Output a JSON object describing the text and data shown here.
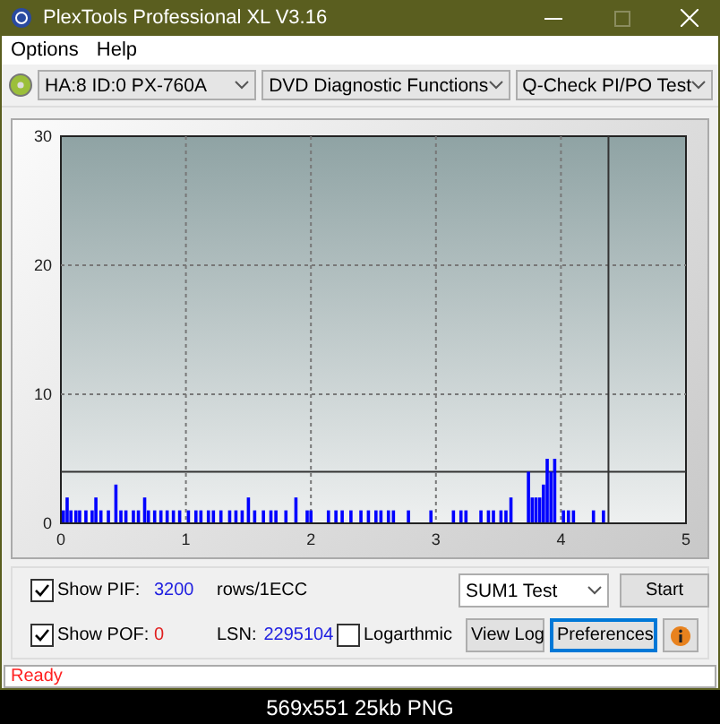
{
  "window": {
    "title": "PlexTools Professional XL V3.16"
  },
  "menu": [
    {
      "label": "Options"
    },
    {
      "label": "Help"
    }
  ],
  "selectors": [
    {
      "value": "HA:8 ID:0  PX-760A"
    },
    {
      "value": "DVD Diagnostic Functions"
    },
    {
      "value": "Q-Check PI/PO Test"
    }
  ],
  "chart": {
    "chart_data": {
      "type": "bar",
      "xlim": [
        0,
        5
      ],
      "ylim": [
        0,
        30
      ],
      "xticks": [
        0,
        1,
        2,
        3,
        4,
        5
      ],
      "yticks": [
        0,
        10,
        20,
        30
      ],
      "grid": true,
      "x": [
        0.02,
        0.05,
        0.08,
        0.12,
        0.15,
        0.2,
        0.25,
        0.28,
        0.32,
        0.38,
        0.44,
        0.48,
        0.52,
        0.58,
        0.62,
        0.67,
        0.7,
        0.75,
        0.8,
        0.85,
        0.9,
        0.95,
        1.02,
        1.08,
        1.12,
        1.18,
        1.22,
        1.28,
        1.35,
        1.4,
        1.45,
        1.5,
        1.55,
        1.62,
        1.68,
        1.72,
        1.8,
        1.88,
        1.97,
        2.0,
        2.14,
        2.2,
        2.25,
        2.32,
        2.4,
        2.46,
        2.52,
        2.56,
        2.62,
        2.66,
        2.78,
        2.96,
        3.14,
        3.2,
        3.24,
        3.36,
        3.42,
        3.46,
        3.52,
        3.56,
        3.6,
        3.74,
        3.77,
        3.8,
        3.83,
        3.86,
        3.89,
        3.92,
        3.95,
        4.02,
        4.06,
        4.1,
        4.26,
        4.34
      ],
      "series": [
        {
          "color": "#0000ff",
          "values": [
            1,
            2,
            1,
            1,
            1,
            1,
            1,
            2,
            1,
            1,
            3,
            1,
            1,
            1,
            1,
            2,
            1,
            1,
            1,
            1,
            1,
            1,
            1,
            1,
            1,
            1,
            1,
            1,
            1,
            1,
            1,
            2,
            1,
            1,
            1,
            1,
            1,
            2,
            1,
            1,
            1,
            1,
            1,
            1,
            1,
            1,
            1,
            1,
            1,
            1,
            1,
            1,
            1,
            1,
            1,
            1,
            1,
            1,
            1,
            1,
            2,
            4,
            2,
            2,
            2,
            3,
            5,
            4,
            5,
            1,
            1,
            1,
            1,
            1
          ]
        }
      ],
      "ref_lines": [
        {
          "axis": "y",
          "value": 4
        },
        {
          "axis": "x",
          "value": 4.38
        }
      ]
    }
  },
  "controls": {
    "show_pif": {
      "label": "Show PIF:",
      "checked": true,
      "value": "3200",
      "unit": "rows/1ECC"
    },
    "show_pof": {
      "label": "Show POF:",
      "checked": true,
      "value": "0"
    },
    "lsn": {
      "label": "LSN:",
      "value": "2295104"
    },
    "logarithmic": {
      "label": "Logarthmic",
      "checked": false
    },
    "test_select": {
      "value": "SUM1 Test"
    },
    "buttons": [
      {
        "label": "Start",
        "selected": false
      },
      {
        "label": "View Log",
        "selected": false
      },
      {
        "label": "Preferences",
        "selected": true
      }
    ]
  },
  "status_bar": {
    "text": "Ready"
  },
  "caption": "569x551 25kb PNG"
}
